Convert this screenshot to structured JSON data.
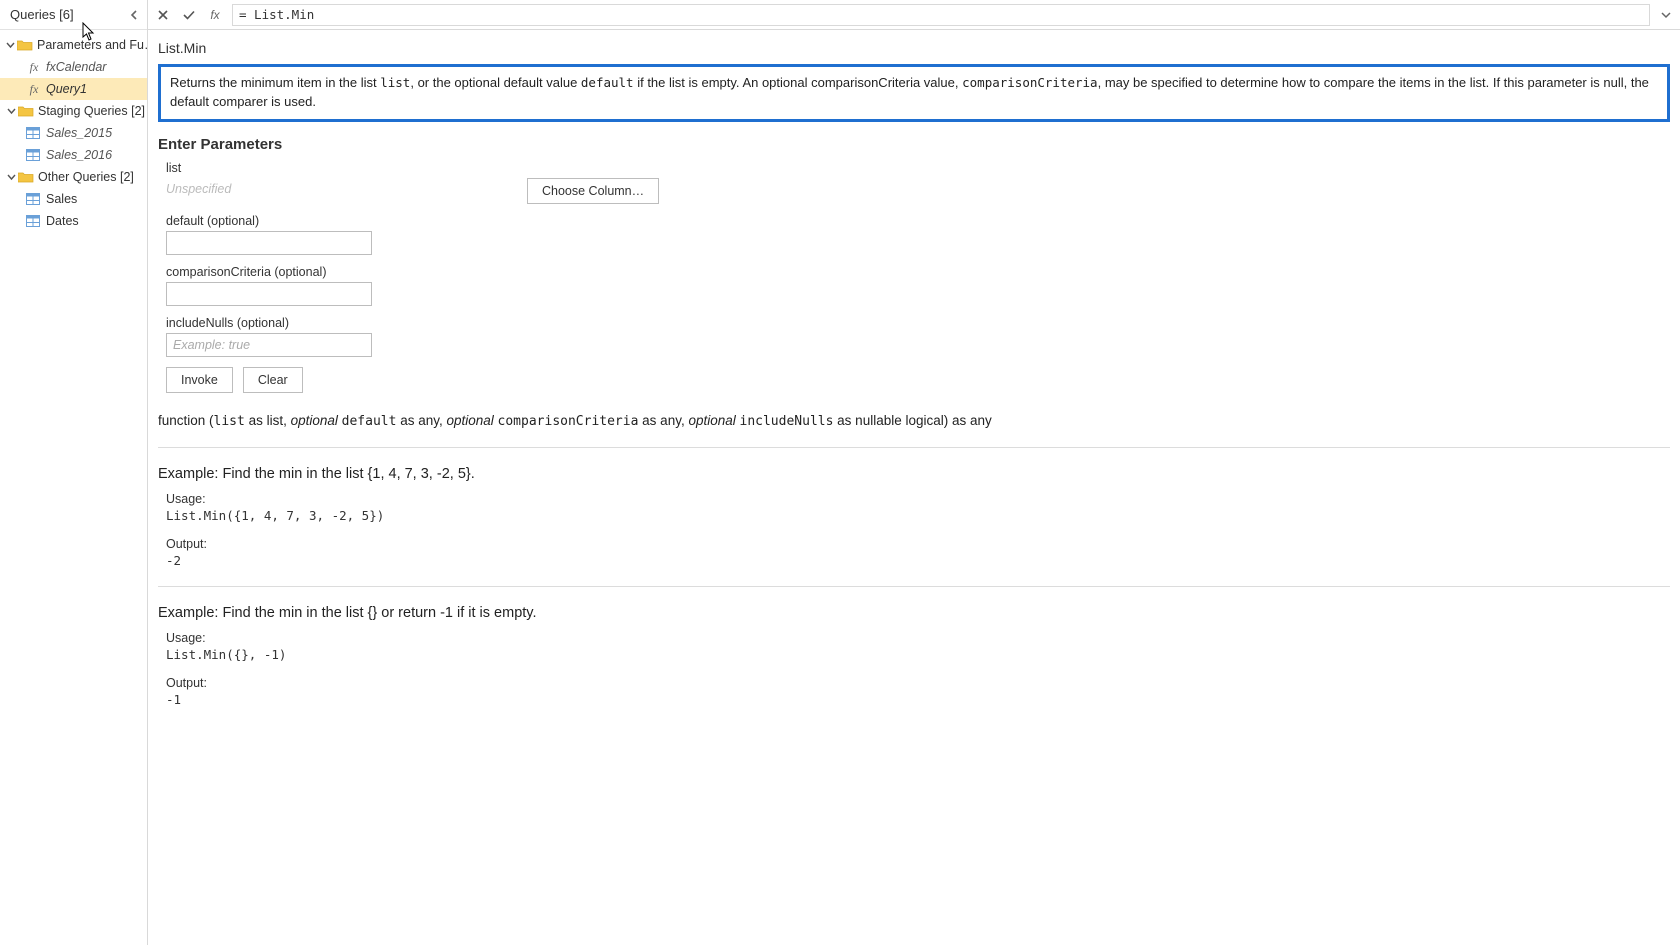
{
  "queries": {
    "header": "Queries [6]",
    "groups": [
      {
        "label": "Parameters and Fu…",
        "children": [
          {
            "label": "fxCalendar",
            "kind": "fx",
            "selected": false
          },
          {
            "label": "Query1",
            "kind": "fx",
            "selected": true
          }
        ]
      },
      {
        "label": "Staging Queries [2]",
        "children": [
          {
            "label": "Sales_2015",
            "kind": "table"
          },
          {
            "label": "Sales_2016",
            "kind": "table"
          }
        ]
      },
      {
        "label": "Other Queries [2]",
        "children": [
          {
            "label": "Sales",
            "kind": "table"
          },
          {
            "label": "Dates",
            "kind": "table"
          }
        ]
      }
    ]
  },
  "formula_bar": {
    "value": "= List.Min"
  },
  "doc": {
    "function_name": "List.Min",
    "description": {
      "pre1": "Returns the minimum item in the list ",
      "code1": "list",
      "mid1": ", or the optional default value ",
      "code2": "default",
      "mid2": " if the list is empty. An optional comparisonCriteria value, ",
      "code3": "comparisonCriteria",
      "mid3": ", may be specified to determine how to compare the items in the list. If this parameter is null, the default comparer is used."
    },
    "enter_parameters_hdr": "Enter Parameters",
    "params": {
      "list_label": "list",
      "list_placeholder": "Unspecified",
      "choose_column_btn": "Choose Column…",
      "default_label": "default (optional)",
      "comparison_label": "comparisonCriteria (optional)",
      "includeNulls_label": "includeNulls (optional)",
      "includeNulls_placeholder": "Example: true",
      "invoke_btn": "Invoke",
      "clear_btn": "Clear"
    },
    "signature": {
      "fn": "function (",
      "p1": "list",
      "p1t": " as list, ",
      "opt": "optional ",
      "p2": "default",
      "p2t": " as any, ",
      "p3": "comparisonCriteria",
      "p3t": " as any, ",
      "p4": "includeNulls",
      "p4t": " as nullable logical) as any"
    },
    "examples": [
      {
        "title": "Example: Find the min in the list {1, 4, 7, 3, -2, 5}.",
        "usage_label": "Usage:",
        "usage_code": "List.Min({1, 4, 7, 3, -2, 5})",
        "output_label": "Output:",
        "output_code": "-2"
      },
      {
        "title": "Example: Find the min in the list {} or return -1 if it is empty.",
        "usage_label": "Usage:",
        "usage_code": "List.Min({}, -1)",
        "output_label": "Output:",
        "output_code": "-1"
      }
    ]
  }
}
